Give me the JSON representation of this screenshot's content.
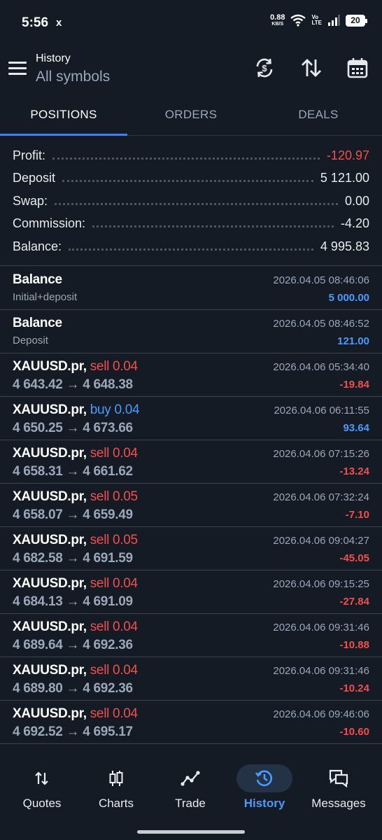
{
  "status_bar": {
    "time": "5:56",
    "notification": "x",
    "speed_value": "0.88",
    "speed_unit": "KB/S",
    "volte_top": "Vo",
    "volte_bottom": "LTE",
    "battery": "20"
  },
  "header": {
    "title": "History",
    "subtitle": "All symbols"
  },
  "tabs": [
    {
      "label": "POSITIONS",
      "active": true
    },
    {
      "label": "ORDERS",
      "active": false
    },
    {
      "label": "DEALS",
      "active": false
    }
  ],
  "summary": {
    "profit": {
      "label": "Profit:",
      "value": "-120.97"
    },
    "deposit": {
      "label": "Deposit",
      "value": "5 121.00"
    },
    "swap": {
      "label": "Swap:",
      "value": "0.00"
    },
    "commission": {
      "label": "Commission:",
      "value": "-4.20"
    },
    "balance": {
      "label": "Balance:",
      "value": "4 995.83"
    }
  },
  "balance_ops": [
    {
      "title": "Balance",
      "comment": "Initial+deposit",
      "time": "2026.04.05 08:46:06",
      "amount": "5 000.00"
    },
    {
      "title": "Balance",
      "comment": "Deposit",
      "time": "2026.04.05 08:46:52",
      "amount": "121.00"
    }
  ],
  "deals": [
    {
      "symbol": "XAUUSD.pr,",
      "side": "sell 0.04",
      "type": "sell",
      "prices": "4 643.42 → 4 648.38",
      "time": "2026.04.06 05:34:40",
      "profit": "-19.84"
    },
    {
      "symbol": "XAUUSD.pr,",
      "side": "buy 0.04",
      "type": "buy",
      "prices": "4 650.25 → 4 673.66",
      "time": "2026.04.06 06:11:55",
      "profit": "93.64"
    },
    {
      "symbol": "XAUUSD.pr,",
      "side": "sell 0.04",
      "type": "sell",
      "prices": "4 658.31 → 4 661.62",
      "time": "2026.04.06 07:15:26",
      "profit": "-13.24"
    },
    {
      "symbol": "XAUUSD.pr,",
      "side": "sell 0.05",
      "type": "sell",
      "prices": "4 658.07 → 4 659.49",
      "time": "2026.04.06 07:32:24",
      "profit": "-7.10"
    },
    {
      "symbol": "XAUUSD.pr,",
      "side": "sell 0.05",
      "type": "sell",
      "prices": "4 682.58 → 4 691.59",
      "time": "2026.04.06 09:04:27",
      "profit": "-45.05"
    },
    {
      "symbol": "XAUUSD.pr,",
      "side": "sell 0.04",
      "type": "sell",
      "prices": "4 684.13 → 4 691.09",
      "time": "2026.04.06 09:15:25",
      "profit": "-27.84"
    },
    {
      "symbol": "XAUUSD.pr,",
      "side": "sell 0.04",
      "type": "sell",
      "prices": "4 689.64 → 4 692.36",
      "time": "2026.04.06 09:31:46",
      "profit": "-10.88"
    },
    {
      "symbol": "XAUUSD.pr,",
      "side": "sell 0.04",
      "type": "sell",
      "prices": "4 689.80 → 4 692.36",
      "time": "2026.04.06 09:31:46",
      "profit": "-10.24"
    },
    {
      "symbol": "XAUUSD.pr,",
      "side": "sell 0.04",
      "type": "sell",
      "prices": "4 692.52 → 4 695.17",
      "time": "2026.04.06 09:46:06",
      "profit": "-10.60"
    }
  ],
  "bottom_nav": [
    {
      "label": "Quotes",
      "icon": "arrows-up-down-icon",
      "active": false
    },
    {
      "label": "Charts",
      "icon": "candlestick-icon",
      "active": false
    },
    {
      "label": "Trade",
      "icon": "trend-line-icon",
      "active": false
    },
    {
      "label": "History",
      "icon": "history-clock-icon",
      "active": true
    },
    {
      "label": "Messages",
      "icon": "chat-bubbles-icon",
      "active": false
    }
  ],
  "colors": {
    "background": "#151b24",
    "accent": "#3b82f6",
    "loss": "#ef4f4f",
    "gain": "#4a9bff",
    "muted_text": "#9aa7b8"
  }
}
